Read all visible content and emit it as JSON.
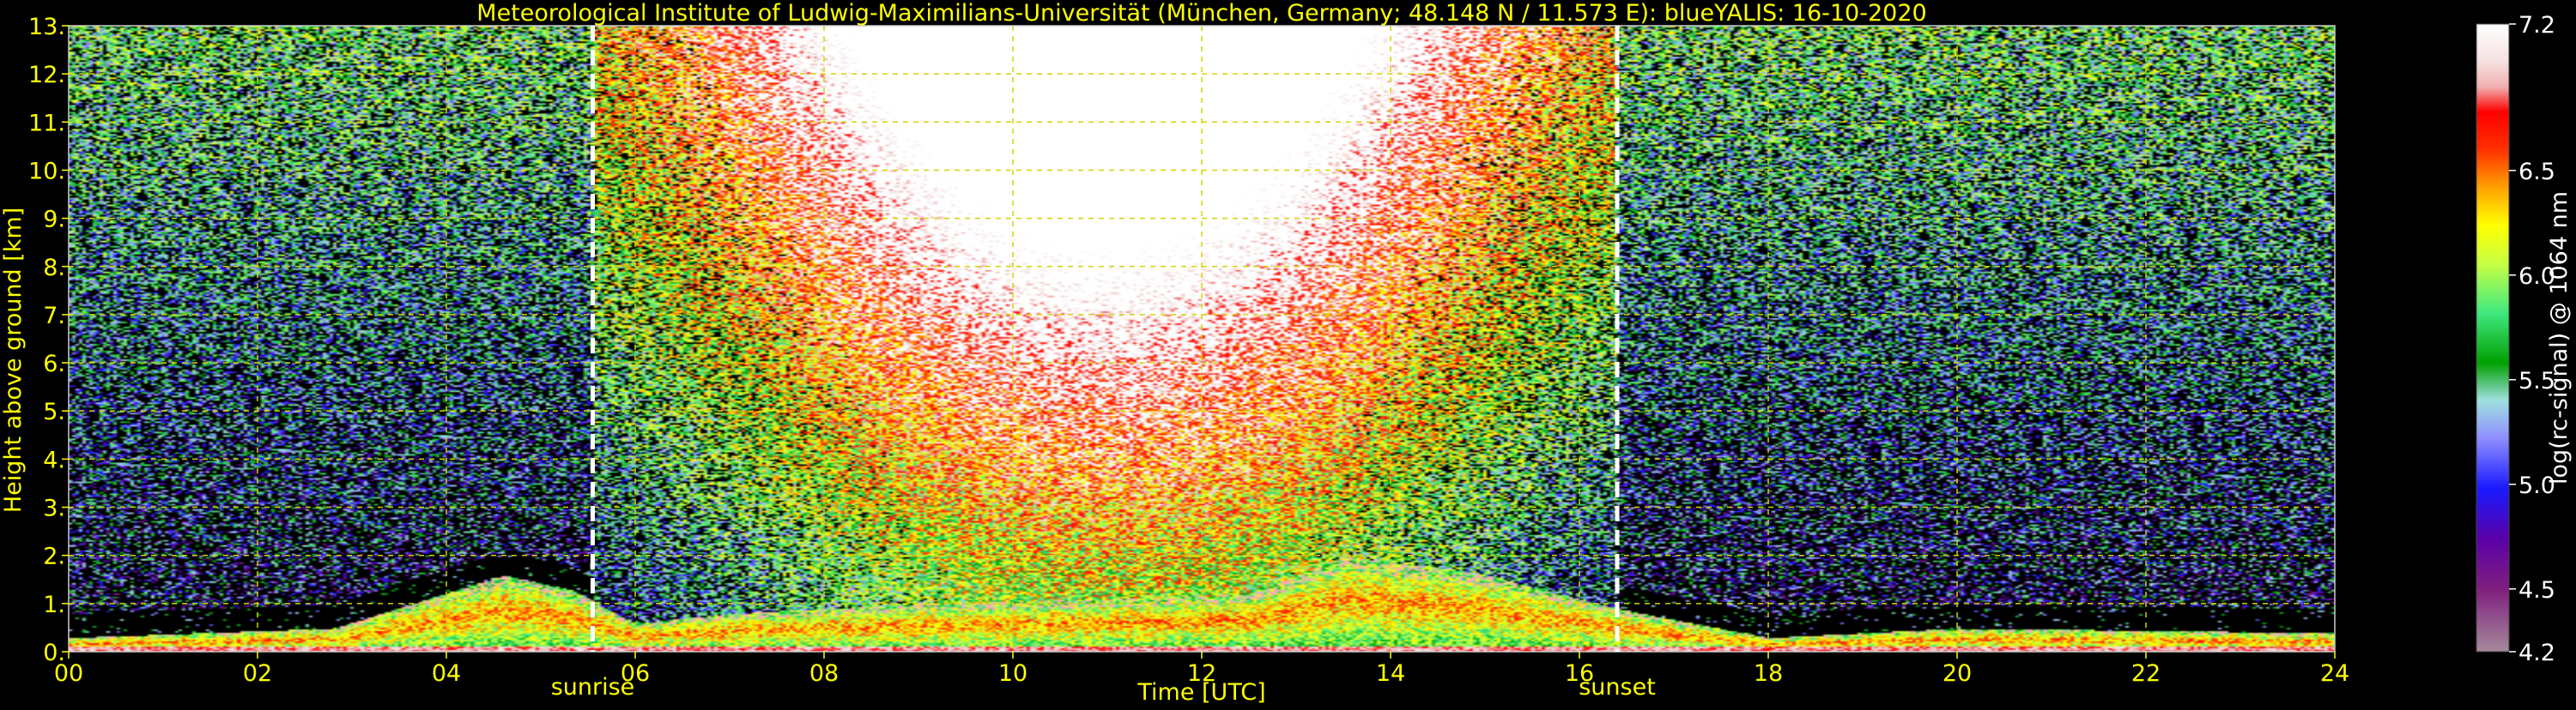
{
  "chart_data": {
    "type": "heatmap",
    "title": "Meteorological Institute of Ludwig-Maximilians-Universität (München, Germany; 48.148 N / 11.573 E):     blueYALIS: 16-10-2020",
    "xlabel": "Time [UTC]",
    "ylabel": "Height above ground [km]",
    "xlim": [
      0,
      24
    ],
    "ylim": [
      0,
      13
    ],
    "x_ticks": [
      "00",
      "02",
      "04",
      "06",
      "08",
      "10",
      "12",
      "14",
      "16",
      "18",
      "20",
      "22",
      "24"
    ],
    "x_tick_values": [
      0,
      2,
      4,
      6,
      8,
      10,
      12,
      14,
      16,
      18,
      20,
      22,
      24
    ],
    "y_ticks": [
      "0.",
      "1.",
      "2.",
      "3.",
      "4.",
      "5.",
      "6.",
      "7.",
      "8.",
      "9.",
      "10.",
      "11.",
      "12.",
      "13."
    ],
    "y_tick_values": [
      0,
      1,
      2,
      3,
      4,
      5,
      6,
      7,
      8,
      9,
      10,
      11,
      12,
      13
    ],
    "grid": true,
    "annotations": [
      {
        "label": "sunrise",
        "x": 5.55
      },
      {
        "label": "sunset",
        "x": 16.4
      }
    ],
    "colorbar": {
      "label": "log(rc-signal) @ 1064 nm",
      "range": [
        4.2,
        7.2
      ],
      "tick_labels": [
        "4.2",
        "4.5",
        "5.0",
        "5.5",
        "6.0",
        "6.5",
        "7.2"
      ],
      "tick_values": [
        4.2,
        4.5,
        5.0,
        5.5,
        6.0,
        6.5,
        7.2
      ]
    },
    "features": {
      "boundary_layer_top_km": [
        [
          0.0,
          0.3
        ],
        [
          2.8,
          0.5
        ],
        [
          4.6,
          1.6
        ],
        [
          5.3,
          1.3
        ],
        [
          6.0,
          0.6
        ],
        [
          7.0,
          0.8
        ],
        [
          9.0,
          1.0
        ],
        [
          11.0,
          1.1
        ],
        [
          12.5,
          1.2
        ],
        [
          13.5,
          2.0
        ],
        [
          15.0,
          1.6
        ],
        [
          16.4,
          0.9
        ],
        [
          18.0,
          0.3
        ],
        [
          20.0,
          0.5
        ],
        [
          24.0,
          0.4
        ]
      ],
      "noise_peak_hour": 11.0
    },
    "colors": {
      "axis_text": "#ffff00",
      "grid": "#d4d400",
      "marker_lines": "#ffffff",
      "background": "#000000"
    }
  }
}
